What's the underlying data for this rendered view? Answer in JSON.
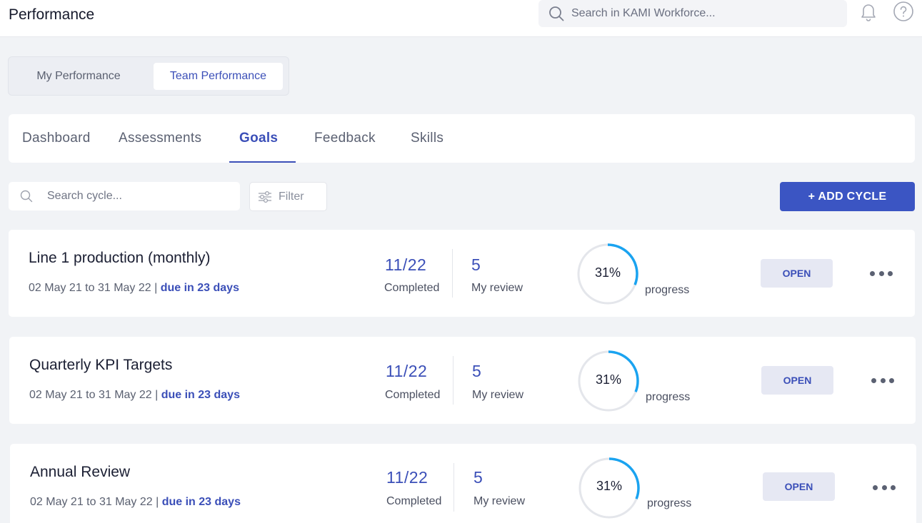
{
  "header": {
    "title": "Performance",
    "search_placeholder": "Search in KAMI Workforce..."
  },
  "view_switch": {
    "options": [
      "My Performance",
      "Team Performance"
    ],
    "active": "Team Performance"
  },
  "tabs": {
    "items": [
      "Dashboard",
      "Assessments",
      "Goals",
      "Feedback",
      "Skills"
    ],
    "active": "Goals"
  },
  "toolbar": {
    "search_placeholder": "Search cycle...",
    "filter_label": "Filter",
    "add_cycle_label": "+ ADD CYCLE"
  },
  "colors": {
    "accent": "#3b55c3",
    "progress_ring": "#1aa3f0",
    "ring_track": "#e4e6eb"
  },
  "cycles": [
    {
      "title": "Line 1 production (monthly)",
      "date_range": "02 May 21 to 31 May 22 | ",
      "due": "due in 23 days",
      "completed_value": "11/22",
      "completed_label": "Completed",
      "review_value": "5",
      "review_label": "My review",
      "progress_text": "31%",
      "progress": 0.31,
      "progress_label": "progress",
      "action_label": "OPEN"
    },
    {
      "title": "Quarterly KPI Targets",
      "date_range": "02 May 21 to 31 May 22 | ",
      "due": "due in 23 days",
      "completed_value": "11/22",
      "completed_label": "Completed",
      "review_value": "5",
      "review_label": "My review",
      "progress_text": "31%",
      "progress": 0.31,
      "progress_label": "progress",
      "action_label": "OPEN"
    },
    {
      "title": "Annual Review",
      "date_range": "02 May 21 to 31 May 22 | ",
      "due": "due in 23 days",
      "completed_value": "11/22",
      "completed_label": "Completed",
      "review_value": "5",
      "review_label": "My review",
      "progress_text": "31%",
      "progress": 0.31,
      "progress_label": "progress",
      "action_label": "OPEN"
    }
  ]
}
